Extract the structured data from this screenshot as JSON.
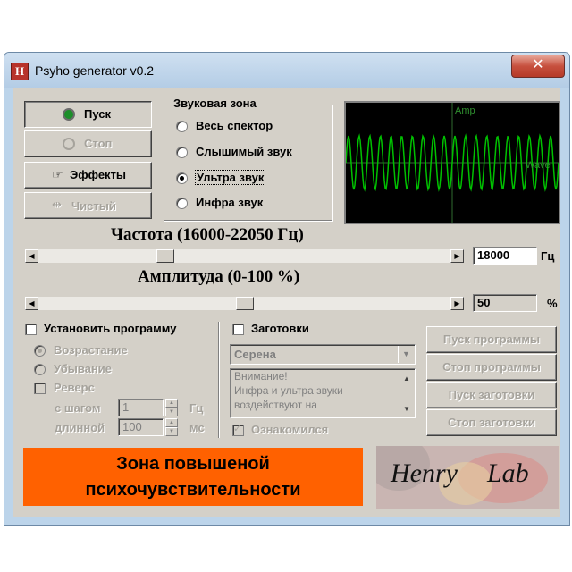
{
  "window": {
    "title": "Psyho generator v0.2",
    "icon_letter": "H",
    "close": "✕"
  },
  "control_buttons": {
    "start": "Пуск",
    "stop": "Стоп",
    "effects": "Эффекты",
    "clear": "Чистый"
  },
  "sound_zone": {
    "title": "Звуковая зона",
    "options": [
      "Весь спектор",
      "Слышимый звук",
      "Ультра звук",
      "Инфра звук"
    ],
    "selected": "Ультра звук"
  },
  "oscilloscope": {
    "amp_label": "Amp",
    "wave_label": "Wave",
    "trace_color": "#00c000"
  },
  "frequency": {
    "label": "Частота (16000-22050 Гц)",
    "value": "18000",
    "unit": "Гц",
    "level": 0.3
  },
  "amplitude": {
    "label": "Амплитуда (0-100 %)",
    "value": "50",
    "unit": "%",
    "level": 0.5
  },
  "program": {
    "checkbox_label": "Установить программу",
    "ascending": "Возрастание",
    "descending": "Убывание",
    "reverse": "Реверс",
    "step_label": "с шагом",
    "step_value": "1",
    "step_unit": "Гц",
    "duration_label": "длинной",
    "duration_value": "100",
    "duration_unit": "мс"
  },
  "presets": {
    "checkbox_label": "Заготовки",
    "selected": "Серена",
    "warning_lines": [
      "Внимание!",
      "Инфра и ультра звуки",
      "воздействуют на"
    ],
    "acknowledge_label": "Ознакомился"
  },
  "action_buttons": {
    "start_program": "Пуск программы",
    "stop_program": "Стоп программы",
    "start_preset": "Пуск заготовки",
    "stop_preset": "Стоп заготовки"
  },
  "banner": {
    "line1": "Зона повышеной",
    "line2": "психочувствительности",
    "color": "#ff6100"
  },
  "logo": {
    "word1": "Henry",
    "word2": "Lab"
  }
}
